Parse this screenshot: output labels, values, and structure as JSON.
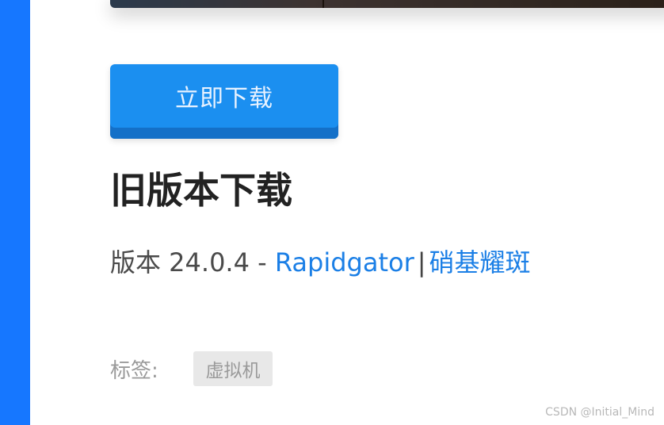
{
  "download_button": {
    "label": "立即下载"
  },
  "old_versions": {
    "heading": "旧版本下载",
    "version_prefix": "版本 24.0.4 - ",
    "links": [
      "Rapidgator",
      "硝基耀斑"
    ],
    "separator": "|"
  },
  "tags": {
    "label": "标签:",
    "items": [
      "虚拟机"
    ]
  },
  "watermark": "CSDN @Initial_Mind",
  "colors": {
    "accent": "#1677ff",
    "button": "#1b8ff0",
    "link": "#1b7fe6"
  }
}
